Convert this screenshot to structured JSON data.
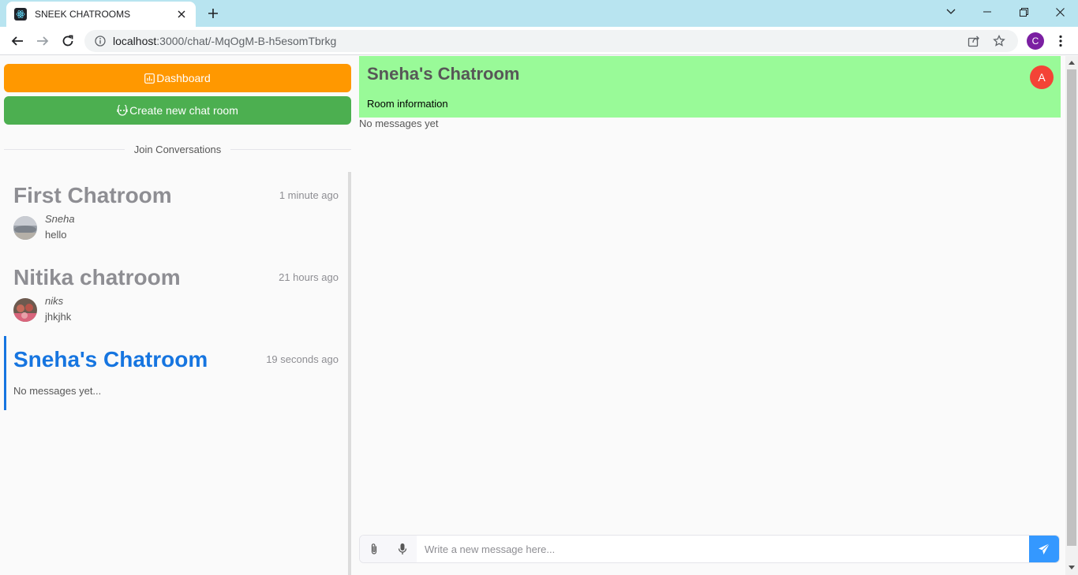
{
  "browser": {
    "tab_title": "SNEEK CHATROOMS",
    "url_host": "localhost",
    "url_rest": ":3000/chat/-MqOgM-B-h5esomTbrkg",
    "profile_initial": "C"
  },
  "sidebar": {
    "dashboard_label": "Dashboard",
    "create_label": "Create new chat room",
    "divider_label": "Join Conversations",
    "rooms": [
      {
        "title": "First Chatroom",
        "time": "1 minute ago",
        "author": "Sneha",
        "message": "hello"
      },
      {
        "title": "Nitika chatroom",
        "time": "21 hours ago",
        "author": "niks",
        "message": "jhkjhk"
      },
      {
        "title": "Sneha's Chatroom",
        "time": "19 seconds ago",
        "message": "No messages yet..."
      }
    ]
  },
  "room": {
    "title": "Sneha's Chatroom",
    "avatar_initial": "A",
    "info_label": "Room information",
    "empty_text": "No messages yet",
    "composer_placeholder": "Write a new message here..."
  },
  "colors": {
    "dashboard": "#ff9800",
    "create": "#4caf50",
    "header": "#99fa98",
    "active": "#1675e0",
    "send": "#3498ff"
  }
}
